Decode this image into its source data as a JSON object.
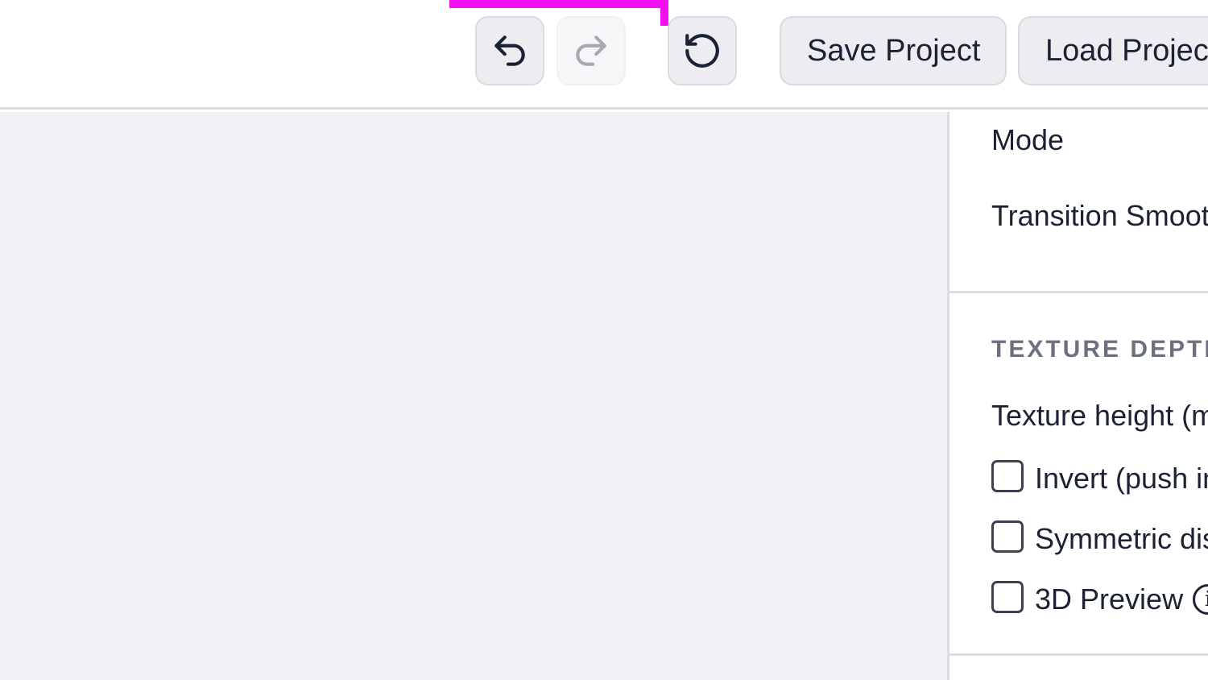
{
  "toolbar": {
    "accent_color": "#f20ff0",
    "undo_icon": "undo-icon",
    "redo_icon": "redo-icon",
    "reset_icon": "reset-icon",
    "save_label": "Save Project",
    "load_label": "Load Project"
  },
  "panel": {
    "mode_label": "Mode",
    "transition_label": "Transition Smoothing",
    "texture_section_title": "TEXTURE DEPTH",
    "texture_height_label": "Texture height (mm)",
    "invert_label": "Invert (push in)",
    "symmetric_label": "Symmetric displacement",
    "preview_label": "3D Preview",
    "info_icon": "info-icon",
    "invert_checked": false,
    "symmetric_checked": false,
    "preview_checked": false
  }
}
